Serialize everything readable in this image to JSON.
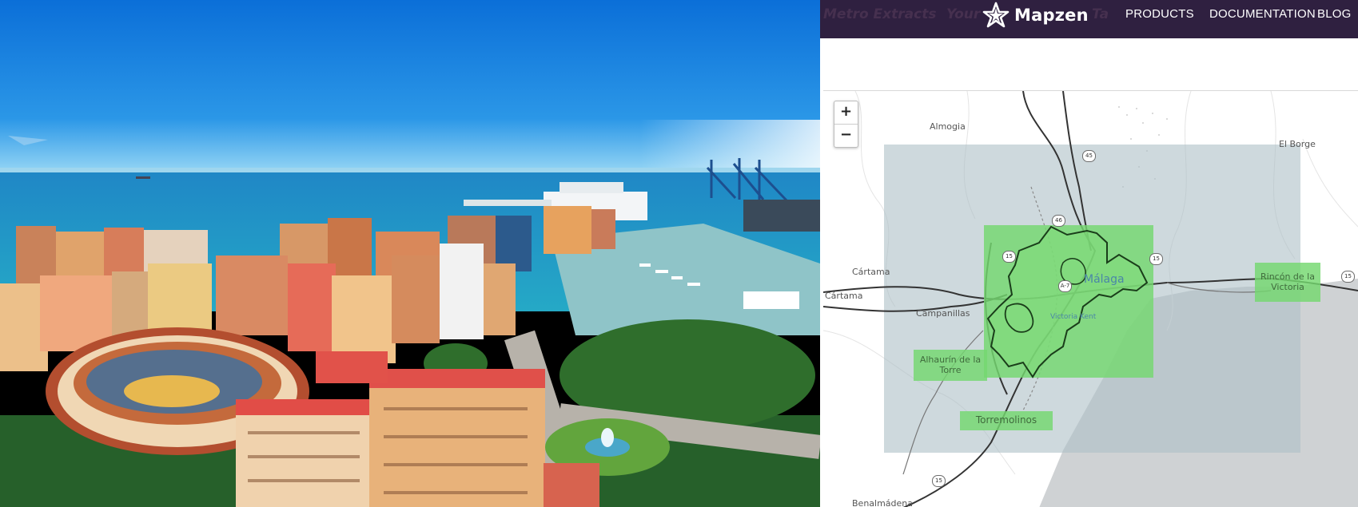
{
  "photo": {
    "description_icon": "malaga-city-photo"
  },
  "header": {
    "faded_tabs": [
      "Metro Extracts",
      "Your",
      "Ta"
    ],
    "logo_text": "Mapzen",
    "nav": [
      "PRODUCTS",
      "DOCUMENTATION",
      "BLOG"
    ]
  },
  "zoom": {
    "in": "+",
    "out": "−"
  },
  "places": {
    "almogia": "Almogia",
    "el_borge": "El Borge",
    "cartama_1": "Cártama",
    "cartama_2": "Cártama",
    "campanillas": "Campanillas",
    "benalmadena": "Benalmádena"
  },
  "city": {
    "malaga": "Málaga",
    "victoria": "Victoria Kent"
  },
  "extract_boxes": {
    "alhaurin": "Alhaurín de la Torre",
    "rincon": "Rincón de la Victoria",
    "torremolinos": "Torremolinos"
  },
  "shields": [
    "45",
    "46",
    "15",
    "15",
    "A-7",
    "15",
    "15"
  ],
  "colors": {
    "navbar": "#2f2040",
    "extract_green": "#74d86f",
    "metro_box": "#aec0c6",
    "sea": "#cfd2d4"
  }
}
